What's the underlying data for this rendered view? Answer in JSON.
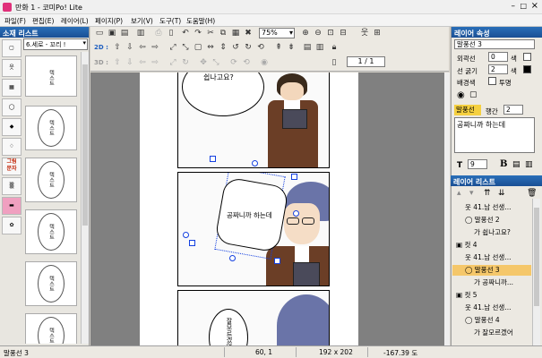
{
  "window": {
    "title": "만화 1 - 코미Po! Lite"
  },
  "menu": [
    "파일(F)",
    "편집(E)",
    "레이어(L)",
    "페이지(P)",
    "보기(V)",
    "도구(T)",
    "도움말(H)"
  ],
  "left": {
    "title": "소재 리스트",
    "category": "6.세로 - 꼬리 !",
    "tool_labels": [
      "그림",
      "문자"
    ],
    "thumb_text": "텍스트"
  },
  "toolbar": {
    "zoom": "75%",
    "mode_2d": "2D :",
    "mode_3d": "3D :",
    "page": "1 / 1"
  },
  "canvas": {
    "bubble1_text": "쉽나고요?",
    "bubble2_text": "공짜니까 하는데",
    "bubble3_text": "잘모르겠어"
  },
  "layer_props": {
    "title": "레이어 속성",
    "name": "말풍선 3",
    "outline_label": "외곽선",
    "outline_value": "0",
    "line_width_label": "선 굵기",
    "line_width_value": "2",
    "background_label": "배경색",
    "color_label": "색",
    "transparent_label": "투명",
    "bubble_label": "말풍선",
    "spacing_label": "행간",
    "spacing_value": "2",
    "text": "공짜니까 하는데",
    "font_size": "9",
    "bold": "B"
  },
  "layer_list": {
    "title": "레이어 리스트",
    "items": [
      {
        "label": "41.남 선생...",
        "indent": 1
      },
      {
        "label": "말풍선 2",
        "indent": 1
      },
      {
        "label": "쉽나고요?",
        "indent": 2
      },
      {
        "label": "컷 4",
        "indent": 0
      },
      {
        "label": "41.남 선생...",
        "indent": 1
      },
      {
        "label": "말풍선 3",
        "indent": 1
      },
      {
        "label": "공짜니까...",
        "indent": 2
      },
      {
        "label": "컷 5",
        "indent": 0
      },
      {
        "label": "41.남 선생...",
        "indent": 1
      },
      {
        "label": "말풍선 4",
        "indent": 1
      },
      {
        "label": "잘모르겠어",
        "indent": 2
      }
    ]
  },
  "status": {
    "layer": "말풍선 3",
    "pos": "60, 1",
    "size": "192 x 202",
    "angle": "-167.39 도"
  },
  "colors": {
    "accent": "#2a6fb8",
    "selection": "#1440e0",
    "highlight": "#f5c76a"
  }
}
